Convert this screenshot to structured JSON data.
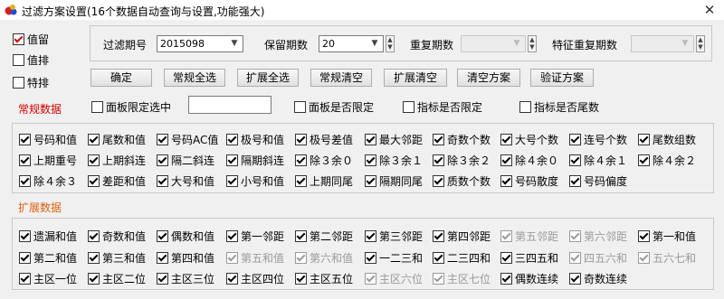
{
  "window": {
    "title": "过滤方案设置(16个数据自动查询与设置,功能强大)",
    "close_glyph": "✕"
  },
  "mode": [
    {
      "label": "值留",
      "checked": true
    },
    {
      "label": "值排",
      "checked": false
    },
    {
      "label": "特排",
      "checked": false
    }
  ],
  "params": {
    "filter_period_label": "过滤期号",
    "filter_period_value": "2015098",
    "keep_periods_label": "保留期数",
    "keep_periods_value": "20",
    "repeat_periods_label": "重复期数",
    "repeat_periods_value": "",
    "feature_repeat_label": "特征重复期数",
    "feature_repeat_value": ""
  },
  "buttons": [
    "确定",
    "常规全选",
    "扩展全选",
    "常规清空",
    "扩展清空",
    "清空方案",
    "验证方案"
  ],
  "options": {
    "section_label": "常规数据",
    "panel_limit_select": {
      "label": "面板限定选中",
      "checked": false
    },
    "panel_limit_text": "",
    "panel_is_limited": {
      "label": "面板是否限定",
      "checked": false
    },
    "index_is_limited": {
      "label": "指标是否限定",
      "checked": false
    },
    "index_is_tail": {
      "label": "指标是否尾数",
      "checked": false
    }
  },
  "regular": {
    "rows": [
      [
        {
          "label": "号码和值",
          "checked": true
        },
        {
          "label": "尾数和值",
          "checked": true
        },
        {
          "label": "号码AC值",
          "checked": true
        },
        {
          "label": "极号和值",
          "checked": true
        },
        {
          "label": "极号差值",
          "checked": true
        },
        {
          "label": "最大邻距",
          "checked": true
        },
        {
          "label": "奇数个数",
          "checked": true
        },
        {
          "label": "大号个数",
          "checked": true
        },
        {
          "label": "连号个数",
          "checked": true
        },
        {
          "label": "尾数组数",
          "checked": true
        }
      ],
      [
        {
          "label": "上期重号",
          "checked": true
        },
        {
          "label": "上期斜连",
          "checked": true
        },
        {
          "label": "隔二斜连",
          "checked": true
        },
        {
          "label": "隔期斜连",
          "checked": true
        },
        {
          "label": "除３余０",
          "checked": true
        },
        {
          "label": "除３余１",
          "checked": true
        },
        {
          "label": "除３余２",
          "checked": true
        },
        {
          "label": "除４余０",
          "checked": true
        },
        {
          "label": "除４余１",
          "checked": true
        },
        {
          "label": "除４余２",
          "checked": true
        }
      ],
      [
        {
          "label": "除４余３",
          "checked": true
        },
        {
          "label": "差距和值",
          "checked": true
        },
        {
          "label": "大号和值",
          "checked": true
        },
        {
          "label": "小号和值",
          "checked": true
        },
        {
          "label": "上期同尾",
          "checked": true
        },
        {
          "label": "隔期同尾",
          "checked": true
        },
        {
          "label": "质数个数",
          "checked": true
        },
        {
          "label": "号码散度",
          "checked": true
        },
        {
          "label": "号码偏度",
          "checked": true
        }
      ]
    ]
  },
  "extended": {
    "section_label": "扩展数据",
    "rows": [
      [
        {
          "label": "遗漏和值",
          "checked": true,
          "enabled": true
        },
        {
          "label": "奇数和值",
          "checked": true,
          "enabled": true
        },
        {
          "label": "偶数和值",
          "checked": true,
          "enabled": true
        },
        {
          "label": "第一邻距",
          "checked": true,
          "enabled": true
        },
        {
          "label": "第二邻距",
          "checked": true,
          "enabled": true
        },
        {
          "label": "第三邻距",
          "checked": true,
          "enabled": true
        },
        {
          "label": "第四邻距",
          "checked": true,
          "enabled": true
        },
        {
          "label": "第五邻距",
          "checked": true,
          "enabled": false
        },
        {
          "label": "第六邻距",
          "checked": true,
          "enabled": false
        },
        {
          "label": "第一和值",
          "checked": true,
          "enabled": true
        }
      ],
      [
        {
          "label": "第二和值",
          "checked": true,
          "enabled": true
        },
        {
          "label": "第三和值",
          "checked": true,
          "enabled": true
        },
        {
          "label": "第四和值",
          "checked": true,
          "enabled": true
        },
        {
          "label": "第五和值",
          "checked": true,
          "enabled": false
        },
        {
          "label": "第六和值",
          "checked": true,
          "enabled": false
        },
        {
          "label": "一二三和",
          "checked": true,
          "enabled": true
        },
        {
          "label": "二三四和",
          "checked": true,
          "enabled": true
        },
        {
          "label": "三四五和",
          "checked": true,
          "enabled": true
        },
        {
          "label": "四五六和",
          "checked": true,
          "enabled": false
        },
        {
          "label": "五六七和",
          "checked": true,
          "enabled": false
        }
      ],
      [
        {
          "label": "主区一位",
          "checked": true,
          "enabled": true
        },
        {
          "label": "主区二位",
          "checked": true,
          "enabled": true
        },
        {
          "label": "主区三位",
          "checked": true,
          "enabled": true
        },
        {
          "label": "主区四位",
          "checked": true,
          "enabled": true
        },
        {
          "label": "主区五位",
          "checked": true,
          "enabled": true
        },
        {
          "label": "主区六位",
          "checked": true,
          "enabled": false
        },
        {
          "label": "主区七位",
          "checked": true,
          "enabled": false
        },
        {
          "label": "偶数连续",
          "checked": true,
          "enabled": true
        },
        {
          "label": "奇数连续",
          "checked": true,
          "enabled": true
        }
      ]
    ]
  }
}
